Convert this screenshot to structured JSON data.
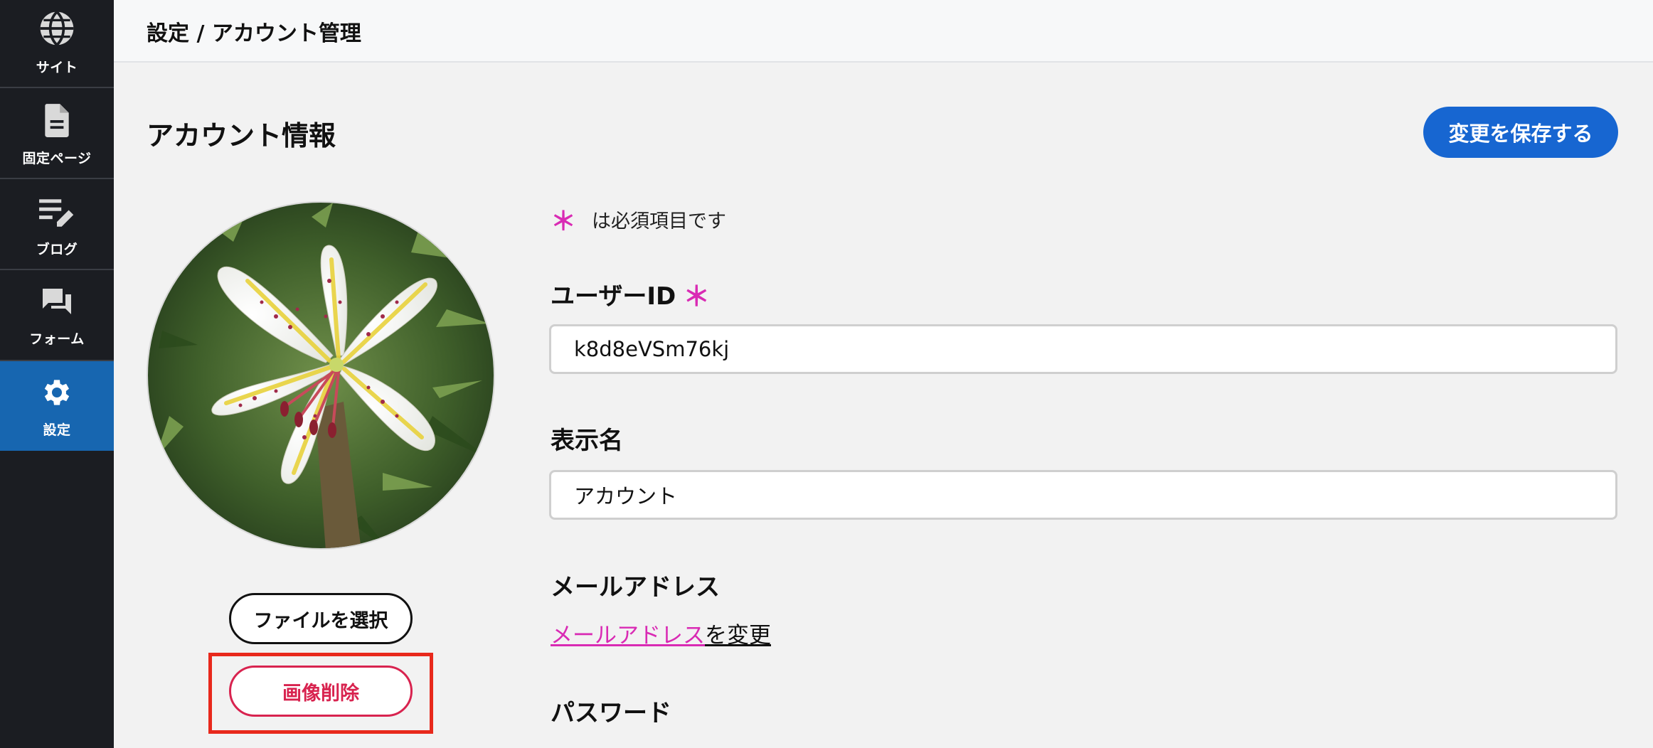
{
  "sidebar": {
    "items": [
      {
        "label": "サイト",
        "icon": "globe-icon"
      },
      {
        "label": "固定ページ",
        "icon": "document-icon"
      },
      {
        "label": "ブログ",
        "icon": "edit-list-icon"
      },
      {
        "label": "フォーム",
        "icon": "chat-icon"
      },
      {
        "label": "設定",
        "icon": "gear-icon",
        "active": true
      }
    ]
  },
  "header": {
    "breadcrumb": "設定 / アカウント管理"
  },
  "main": {
    "title": "アカウント情報",
    "save_label": "変更を保存する",
    "required_note": "は必須項目です",
    "required_mark": "＊",
    "avatar": {
      "alt": "lily-photo"
    },
    "file_button_label": "ファイルを選択",
    "delete_button_label": "画像削除",
    "user_id": {
      "label": "ユーザーID",
      "value": "k8d8eVSm76kj"
    },
    "display_name": {
      "label": "表示名",
      "value": "アカウント"
    },
    "email": {
      "label": "メールアドレス",
      "link_text": "メールアドレス",
      "suffix": "を変更"
    },
    "password": {
      "label": "パスワード"
    }
  },
  "colors": {
    "sidebar_bg": "#1b1d22",
    "active_bg": "#1766b0",
    "primary": "#1766d1",
    "required": "#d92bb4",
    "danger": "#d8234f",
    "highlight": "#e8291c"
  }
}
